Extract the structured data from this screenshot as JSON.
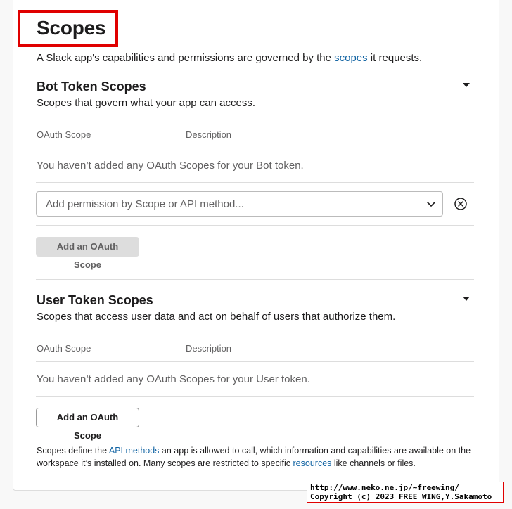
{
  "page": {
    "title": "Scopes",
    "intro_before": "A Slack app's capabilities and permissions are governed by the ",
    "intro_link": "scopes",
    "intro_after": " it requests."
  },
  "bot_section": {
    "title": "Bot Token Scopes",
    "subtitle": "Scopes that govern what your app can access.",
    "col_scope": "OAuth Scope",
    "col_description": "Description",
    "empty_text": "You haven’t added any OAuth Scopes for your Bot token.",
    "select_placeholder": "Add permission by Scope or API method...",
    "add_button": "Add an OAuth Scope"
  },
  "user_section": {
    "title": "User Token Scopes",
    "subtitle": "Scopes that access user data and act on behalf of users that authorize them.",
    "col_scope": "OAuth Scope",
    "col_description": "Description",
    "empty_text": "You haven’t added any OAuth Scopes for your User token.",
    "add_button": "Add an OAuth Scope"
  },
  "footer": {
    "part1": "Scopes define the ",
    "link1": "API methods",
    "part2": " an app is allowed to call, which information and capabilities are available on the workspace it’s installed on. Many scopes are restricted to specific ",
    "link2": "resources",
    "part3": " like channels or files."
  },
  "watermark": {
    "line1": "http://www.neko.ne.jp/~freewing/",
    "line2": "Copyright (c) 2023 FREE WING,Y.Sakamoto"
  },
  "colors": {
    "link": "#1264a3",
    "highlight": "#e00000",
    "muted_text": "#616061"
  },
  "icons": {
    "caret": "caret-down-icon",
    "chevron": "chevron-down-icon",
    "clear": "circle-x-icon"
  }
}
